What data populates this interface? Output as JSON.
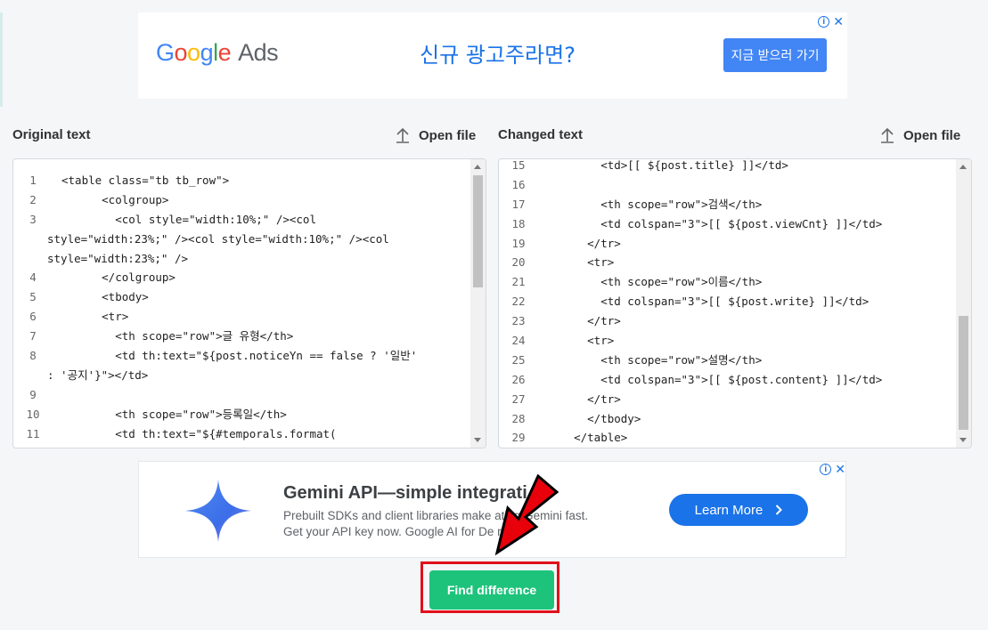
{
  "top_ad": {
    "logo_google": [
      "G",
      "o",
      "o",
      "g",
      "l",
      "e"
    ],
    "logo_ads": "Ads",
    "headline": "신규 광고주라면?",
    "cta": "지금 받으러 가기",
    "close": "✕"
  },
  "left_panel": {
    "title": "Original text",
    "open_file": "Open file",
    "lines": [
      {
        "n": "1",
        "code": "<table class=\"tb tb_row\">"
      },
      {
        "n": "2",
        "code": "      <colgroup>"
      },
      {
        "n": "3",
        "code": "        <col style=\"width:10%;\" /><col"
      },
      {
        "n": "",
        "code": "style=\"width:23%;\" /><col style=\"width:10%;\" /><col"
      },
      {
        "n": "",
        "code": "style=\"width:23%;\" />"
      },
      {
        "n": "4",
        "code": "      </colgroup>"
      },
      {
        "n": "5",
        "code": "      <tbody>"
      },
      {
        "n": "6",
        "code": "      <tr>"
      },
      {
        "n": "7",
        "code": "        <th scope=\"row\">글 유형</th>"
      },
      {
        "n": "8",
        "code": "        <td th:text=\"${post.noticeYn == false ? '일반'"
      },
      {
        "n": "",
        "code": ": '공지'}\"></td>"
      },
      {
        "n": "9",
        "code": ""
      },
      {
        "n": "10",
        "code": "        <th scope=\"row\">등록일</th>"
      },
      {
        "n": "11",
        "code": "        <td th:text=\"${#temporals.format("
      }
    ]
  },
  "right_panel": {
    "title": "Changed text",
    "open_file": "Open file",
    "lines": [
      {
        "n": "15",
        "code": "        <td>[[ ${post.title} ]]</td>"
      },
      {
        "n": "16",
        "code": ""
      },
      {
        "n": "17",
        "code": "        <th scope=\"row\">검색</th>"
      },
      {
        "n": "18",
        "code": "        <td colspan=\"3\">[[ ${post.viewCnt} ]]</td>"
      },
      {
        "n": "19",
        "code": "      </tr>"
      },
      {
        "n": "20",
        "code": "      <tr>"
      },
      {
        "n": "21",
        "code": "        <th scope=\"row\">이름</th>"
      },
      {
        "n": "22",
        "code": "        <td colspan=\"3\">[[ ${post.write} ]]</td>"
      },
      {
        "n": "23",
        "code": "      </tr>"
      },
      {
        "n": "24",
        "code": "      <tr>"
      },
      {
        "n": "25",
        "code": "        <th scope=\"row\">설명</th>"
      },
      {
        "n": "26",
        "code": "        <td colspan=\"3\">[[ ${post.content} ]]</td>"
      },
      {
        "n": "27",
        "code": "      </tr>"
      },
      {
        "n": "28",
        "code": "      </tbody>"
      },
      {
        "n": "29",
        "code": "    </table>"
      }
    ]
  },
  "bottom_ad": {
    "title": "Gemini API—simple integrati",
    "desc_line1": "Prebuilt SDKs and client libraries make         ating Gemini fast.",
    "desc_line2": "Get your API key now. Google AI for De            rs",
    "cta": "Learn More",
    "close": "✕"
  },
  "action": {
    "find_difference": "Find difference"
  },
  "colors": {
    "primary_green": "#1ec37b",
    "highlight_red": "#e0101a",
    "ad_blue": "#1a73e8"
  }
}
